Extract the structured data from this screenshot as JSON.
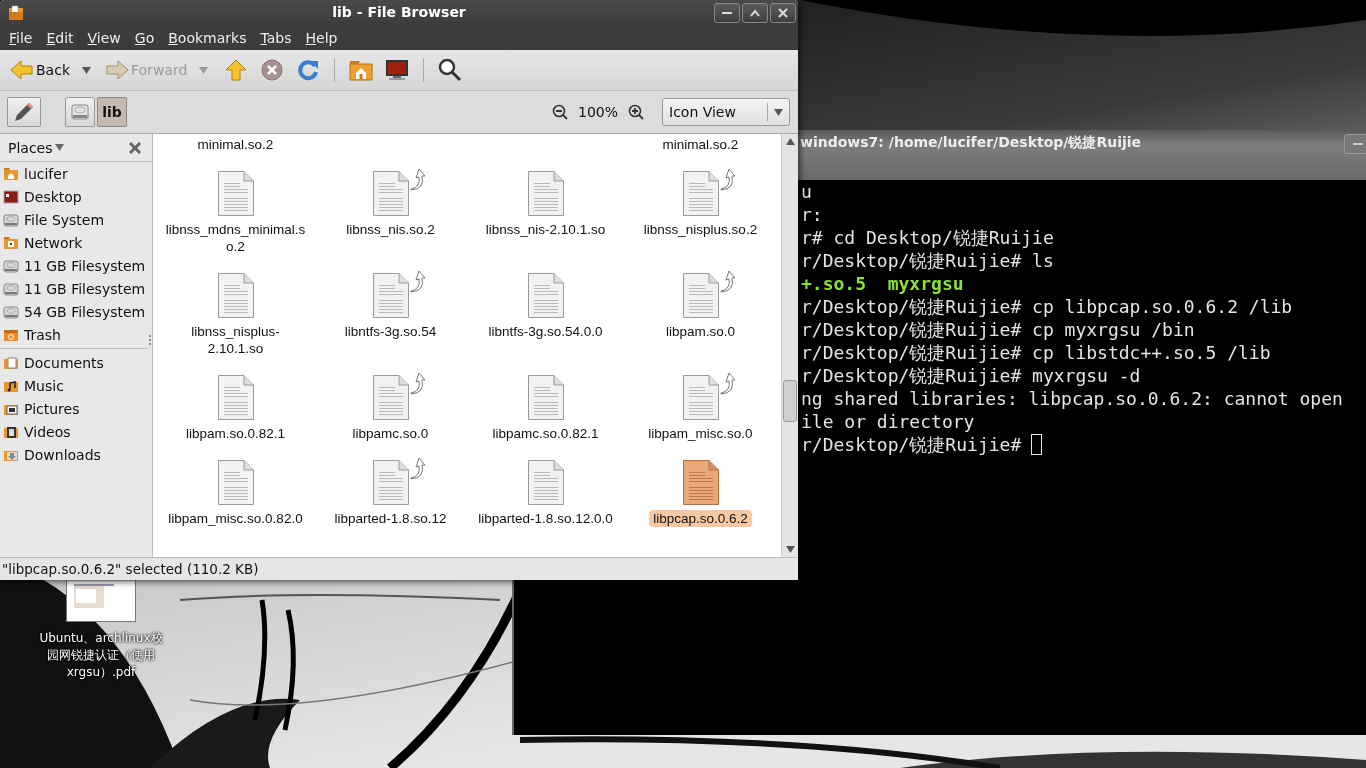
{
  "file_browser": {
    "title": "lib - File Browser",
    "menu": [
      "File",
      "Edit",
      "View",
      "Go",
      "Bookmarks",
      "Tabs",
      "Help"
    ],
    "toolbar": {
      "back": {
        "label": "Back",
        "disabled": false
      },
      "forward": {
        "label": "Forward",
        "disabled": true
      }
    },
    "path": [
      {
        "kind": "drive",
        "selected": false
      },
      {
        "kind": "folder",
        "label": "lib",
        "selected": true
      }
    ],
    "zoom": "100%",
    "view_mode": "Icon View",
    "sidebar": {
      "title": "Places",
      "sections": [
        [
          {
            "label": "lucifer",
            "kind": "home"
          },
          {
            "label": "Desktop",
            "kind": "desktop"
          },
          {
            "label": "File System",
            "kind": "drive"
          },
          {
            "label": "Network",
            "kind": "network"
          },
          {
            "label": "11 GB Filesystem",
            "kind": "drive"
          },
          {
            "label": "11 GB Filesystem",
            "kind": "drive"
          },
          {
            "label": "54 GB Filesystem",
            "kind": "drive"
          },
          {
            "label": "Trash",
            "kind": "trash"
          }
        ],
        [
          {
            "label": "Documents",
            "kind": "documents"
          },
          {
            "label": "Music",
            "kind": "music"
          },
          {
            "label": "Pictures",
            "kind": "pictures"
          },
          {
            "label": "Videos",
            "kind": "videos"
          },
          {
            "label": "Downloads",
            "kind": "downloads"
          }
        ]
      ]
    },
    "files": [
      {
        "kind": "clipped",
        "name": "minimal.so.2"
      },
      {
        "kind": "blank"
      },
      {
        "kind": "blank"
      },
      {
        "kind": "clipped",
        "name": "minimal.so.2"
      },
      {
        "kind": "file",
        "name": "libnss_mdns_minimal.so.2",
        "symlink": false,
        "selected": false
      },
      {
        "kind": "file",
        "name": "libnss_nis.so.2",
        "symlink": true,
        "selected": false
      },
      {
        "kind": "file",
        "name": "libnss_nis-2.10.1.so",
        "symlink": false,
        "selected": false
      },
      {
        "kind": "file",
        "name": "libnss_nisplus.so.2",
        "symlink": true,
        "selected": false
      },
      {
        "kind": "file",
        "name": "libnss_nisplus-2.10.1.so",
        "symlink": false,
        "selected": false
      },
      {
        "kind": "file",
        "name": "libntfs-3g.so.54",
        "symlink": true,
        "selected": false
      },
      {
        "kind": "file",
        "name": "libntfs-3g.so.54.0.0",
        "symlink": false,
        "selected": false
      },
      {
        "kind": "file",
        "name": "libpam.so.0",
        "symlink": true,
        "selected": false
      },
      {
        "kind": "file",
        "name": "libpam.so.0.82.1",
        "symlink": false,
        "selected": false
      },
      {
        "kind": "file",
        "name": "libpamc.so.0",
        "symlink": true,
        "selected": false
      },
      {
        "kind": "file",
        "name": "libpamc.so.0.82.1",
        "symlink": false,
        "selected": false
      },
      {
        "kind": "file",
        "name": "libpam_misc.so.0",
        "symlink": true,
        "selected": false
      },
      {
        "kind": "file",
        "name": "libpam_misc.so.0.82.0",
        "symlink": false,
        "selected": false
      },
      {
        "kind": "file",
        "name": "libparted-1.8.so.12",
        "symlink": true,
        "selected": false
      },
      {
        "kind": "file",
        "name": "libparted-1.8.so.12.0.0",
        "symlink": false,
        "selected": false
      },
      {
        "kind": "file",
        "name": "libpcap.so.0.6.2",
        "symlink": false,
        "selected": true
      }
    ],
    "status": "\"libpcap.so.0.6.2\" selected (110.2 KB)"
  },
  "terminal": {
    "title": "windows7: /home/lucifer/Desktop/锐捷Ruijie",
    "lines": [
      {
        "kind": "text",
        "text": "u"
      },
      {
        "kind": "text",
        "text": "r:"
      },
      {
        "kind": "text",
        "text": "r# cd Desktop/锐捷Ruijie"
      },
      {
        "kind": "text",
        "text": "r/Desktop/锐捷Ruijie# ls"
      },
      {
        "kind": "listing",
        "text": "+.so.5  myxrgsu"
      },
      {
        "kind": "text",
        "text": "r/Desktop/锐捷Ruijie# cp libpcap.so.0.6.2 /lib"
      },
      {
        "kind": "text",
        "text": "r/Desktop/锐捷Ruijie# cp myxrgsu /bin"
      },
      {
        "kind": "text",
        "text": "r/Desktop/锐捷Ruijie# cp libstdc++.so.5 /lib"
      },
      {
        "kind": "text",
        "text": "r/Desktop/锐捷Ruijie# myxrgsu -d"
      },
      {
        "kind": "text",
        "text": "ng shared libraries: libpcap.so.0.6.2: cannot open"
      },
      {
        "kind": "text",
        "text": "ile or directory"
      },
      {
        "kind": "text",
        "text": "r/Desktop/锐捷Ruijie#"
      }
    ],
    "cursor": true
  },
  "desktop_icon": {
    "label_lines": [
      "Ubuntu、archlinux校",
      "园网锐捷认证（使用",
      "xrgsu）.pdf"
    ]
  }
}
